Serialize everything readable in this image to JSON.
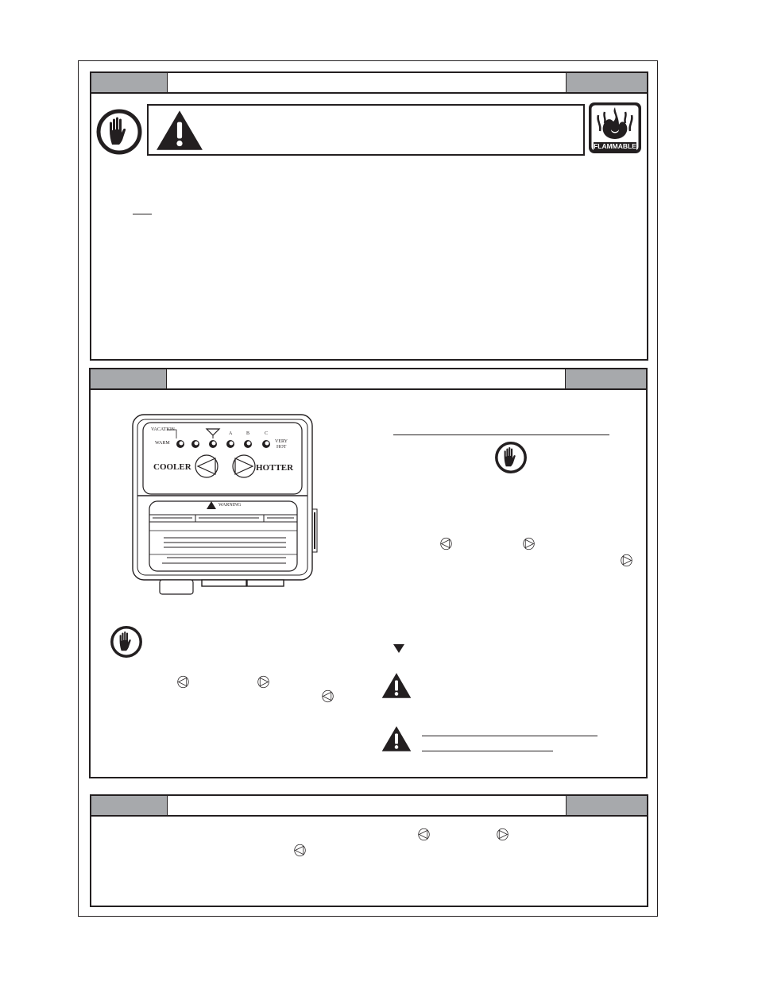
{
  "sections": [
    {
      "id": "section-1",
      "header_left": "",
      "header_title": "",
      "header_right": ""
    },
    {
      "id": "section-2",
      "header_left": "",
      "header_title": "",
      "header_right": ""
    },
    {
      "id": "section-3",
      "header_left": "",
      "header_title": "",
      "header_right": ""
    }
  ],
  "icons": {
    "stop_hand": "stop-hand-icon",
    "warning_triangle": "warning-triangle-icon",
    "flammable": "flammable-icon",
    "cooler_button": "cooler-button-icon",
    "hotter_button": "hotter-button-icon",
    "down_triangle": "down-triangle-icon"
  },
  "flammable_label": "FLAMMABLE",
  "control_panel": {
    "vacation_label": "VACATION",
    "warm_label": "WARM",
    "setting_a": "A",
    "setting_b": "B",
    "setting_c": "C",
    "very_label": "VERY",
    "hot_label": "HOT",
    "cooler_label": "COOLER",
    "hotter_label": "HOTTER",
    "warning_label": "WARNING"
  },
  "colors": {
    "ink": "#231f20",
    "header_gray": "#a7a9ac"
  }
}
